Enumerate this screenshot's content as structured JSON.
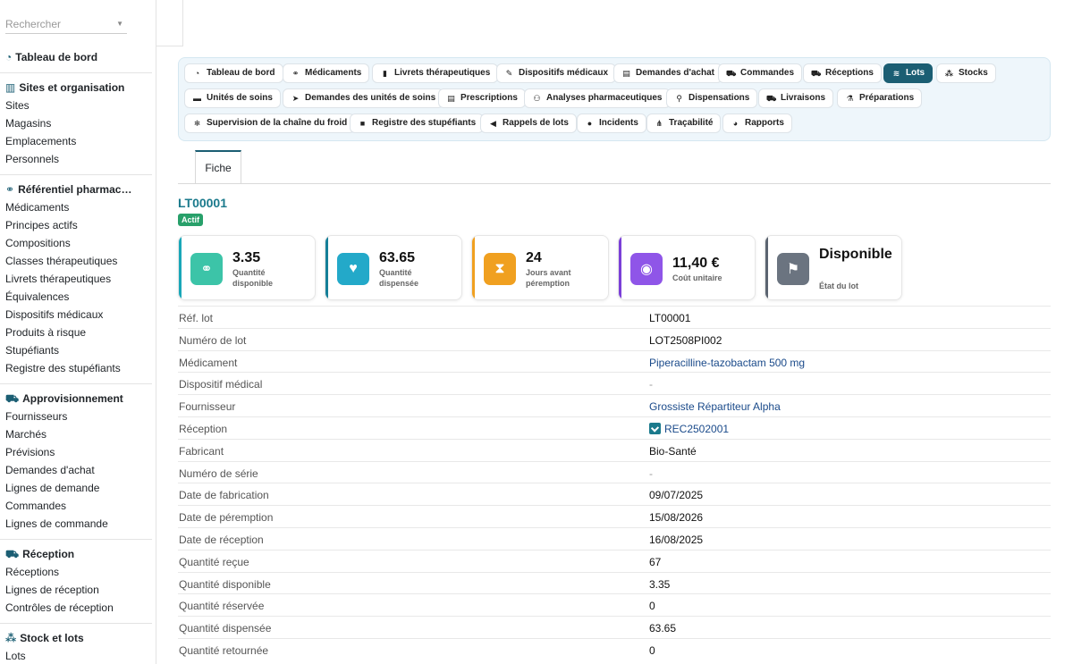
{
  "search": {
    "placeholder": "Rechercher"
  },
  "sidebar": {
    "sections": [
      {
        "title": "Tableau de bord",
        "icon": "gauge-icon",
        "items": []
      },
      {
        "title": "Sites et organisation",
        "icon": "building-icon",
        "items": [
          "Sites",
          "Magasins",
          "Emplacements",
          "Personnels"
        ]
      },
      {
        "title": "Référentiel pharmac…",
        "icon": "pills-icon",
        "items": [
          "Médicaments",
          "Principes actifs",
          "Compositions",
          "Classes thérapeutiques",
          "Livrets thérapeutiques",
          "Équivalences",
          "Dispositifs médicaux",
          "Produits à risque",
          "Stupéfiants",
          "Registre des stupéfiants"
        ]
      },
      {
        "title": "Approvisionnement",
        "icon": "cart-icon",
        "items": [
          "Fournisseurs",
          "Marchés",
          "Prévisions",
          "Demandes d'achat",
          "Lignes de demande",
          "Commandes",
          "Lignes de commande"
        ]
      },
      {
        "title": "Réception",
        "icon": "truck-loading-icon",
        "items": [
          "Réceptions",
          "Lignes de réception",
          "Contrôles de réception"
        ]
      },
      {
        "title": "Stock et lots",
        "icon": "cubes-icon",
        "items": [
          "Lots"
        ]
      }
    ]
  },
  "menu": {
    "chips": [
      {
        "label": "Tableau de bord",
        "icon": "gauge-icon",
        "glyph": "◔"
      },
      {
        "label": "Médicaments",
        "icon": "pills-icon",
        "glyph": "⚭"
      },
      {
        "label": "Livrets thérapeutiques",
        "icon": "book-icon",
        "glyph": "▮"
      },
      {
        "label": "Dispositifs médicaux",
        "icon": "syringe-icon",
        "glyph": "✎"
      },
      {
        "label": "Demandes d'achat",
        "icon": "file-icon",
        "glyph": "▤"
      },
      {
        "label": "Commandes",
        "icon": "cart-icon",
        "glyph": "⛟"
      },
      {
        "label": "Réceptions",
        "icon": "truck-loading-icon",
        "glyph": "⛟"
      },
      {
        "label": "Lots",
        "icon": "layers-icon",
        "glyph": "≋",
        "active": true
      },
      {
        "label": "Stocks",
        "icon": "cubes-icon",
        "glyph": "⁂"
      },
      {
        "label": "Unités de soins",
        "icon": "bed-icon",
        "glyph": "▬"
      },
      {
        "label": "Demandes des unités de soins",
        "icon": "paper-plane-icon",
        "glyph": "➤"
      },
      {
        "label": "Prescriptions",
        "icon": "prescription-icon",
        "glyph": "▤"
      },
      {
        "label": "Analyses pharmaceutiques",
        "icon": "user-md-icon",
        "glyph": "⚇"
      },
      {
        "label": "Dispensations",
        "icon": "hand-pills-icon",
        "glyph": "⚲"
      },
      {
        "label": "Livraisons",
        "icon": "truck-icon",
        "glyph": "⛟"
      },
      {
        "label": "Préparations",
        "icon": "mortar-icon",
        "glyph": "⚗"
      },
      {
        "label": "Supervision de la chaîne du froid",
        "icon": "snowflake-icon",
        "glyph": "❄"
      },
      {
        "label": "Registre des stupéfiants",
        "icon": "lock-icon",
        "glyph": "■"
      },
      {
        "label": "Rappels de lots",
        "icon": "bullhorn-icon",
        "glyph": "◀"
      },
      {
        "label": "Incidents",
        "icon": "alert-circle-icon",
        "glyph": "●"
      },
      {
        "label": "Traçabilité",
        "icon": "sitemap-icon",
        "glyph": "⋔"
      },
      {
        "label": "Rapports",
        "icon": "pie-chart-icon",
        "glyph": "◕"
      }
    ]
  },
  "tabs": {
    "fiche": "Fiche"
  },
  "record": {
    "title": "LT00001",
    "status": "Actif",
    "kpis": [
      {
        "value": "3.35",
        "label": "Quantité disponible",
        "icon": "pills-icon",
        "color": "#3cc4a8",
        "bar": "#19a7b8"
      },
      {
        "value": "63.65",
        "label": "Quantité dispensée",
        "icon": "hand-heart-icon",
        "color": "#23a9c9",
        "bar": "#157f98"
      },
      {
        "value": "24",
        "label": "Jours avant péremption",
        "icon": "hourglass-icon",
        "color": "#f0a020",
        "bar": "#f0a020"
      },
      {
        "value": "11,40 €",
        "label": "Coût unitaire",
        "icon": "coins-icon",
        "color": "#8f55e8",
        "bar": "#7b3fd8"
      },
      {
        "value": "Disponible",
        "label": "État du lot",
        "icon": "flag-icon",
        "color": "#6b7480",
        "bar": "#5b6470"
      }
    ],
    "fields": [
      {
        "key": "Réf. lot",
        "value": "LT00001"
      },
      {
        "key": "Numéro de lot",
        "value": "LOT2508PI002"
      },
      {
        "key": "Médicament",
        "value": "Piperacilline-tazobactam 500 mg",
        "link": true
      },
      {
        "key": "Dispositif médical",
        "value": "-",
        "muted": true
      },
      {
        "key": "Fournisseur",
        "value": "Grossiste Répartiteur Alpha",
        "link": true
      },
      {
        "key": "Réception",
        "value": "REC2502001",
        "link": true,
        "icon": "reception-icon"
      },
      {
        "key": "Fabricant",
        "value": "Bio-Santé"
      },
      {
        "key": "Numéro de série",
        "value": "-",
        "muted": true
      },
      {
        "key": "Date de fabrication",
        "value": "09/07/2025"
      },
      {
        "key": "Date de péremption",
        "value": "15/08/2026"
      },
      {
        "key": "Date de réception",
        "value": "16/08/2025"
      },
      {
        "key": "Quantité reçue",
        "value": "67"
      },
      {
        "key": "Quantité disponible",
        "value": "3.35"
      },
      {
        "key": "Quantité réservée",
        "value": "0"
      },
      {
        "key": "Quantité dispensée",
        "value": "63.65"
      },
      {
        "key": "Quantité retournée",
        "value": "0"
      }
    ]
  }
}
